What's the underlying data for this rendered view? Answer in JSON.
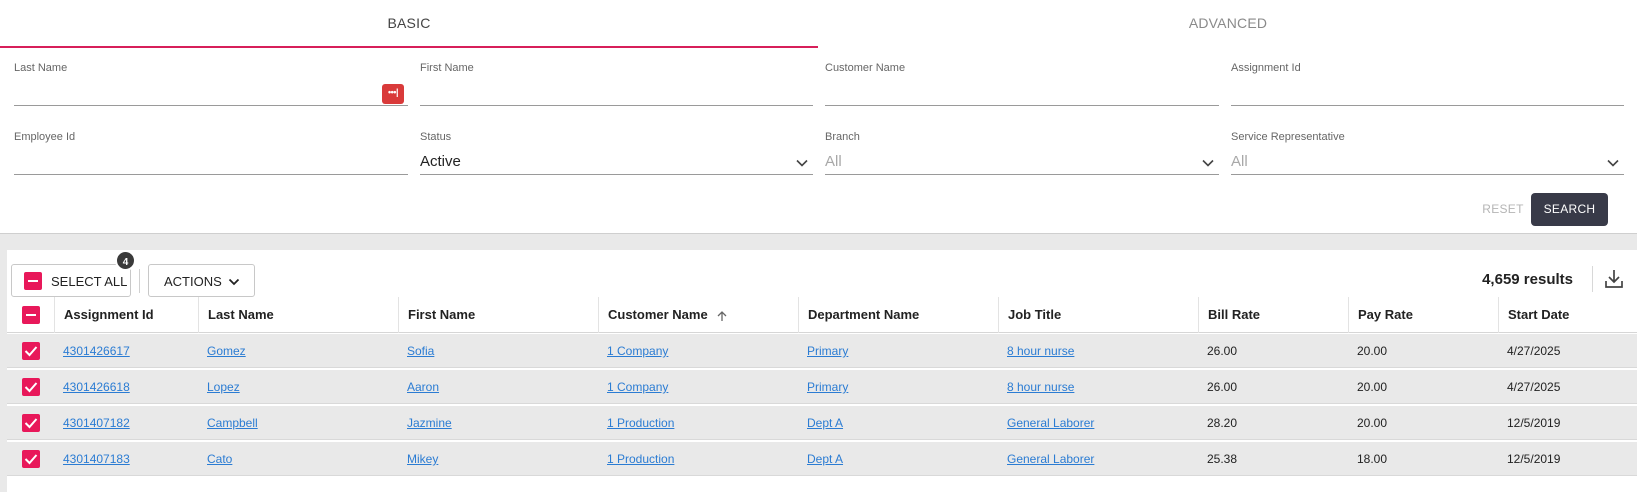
{
  "tabs": [
    {
      "label": "BASIC",
      "active": true
    },
    {
      "label": "ADVANCED",
      "active": false
    }
  ],
  "filters": {
    "last_name": {
      "label": "Last Name",
      "value": ""
    },
    "first_name": {
      "label": "First Name",
      "value": ""
    },
    "customer_name": {
      "label": "Customer Name",
      "value": ""
    },
    "assignment_id": {
      "label": "Assignment Id",
      "value": ""
    },
    "employee_id": {
      "label": "Employee Id",
      "value": ""
    },
    "status": {
      "label": "Status",
      "value": "Active"
    },
    "branch": {
      "label": "Branch",
      "placeholder": "All"
    },
    "service_rep": {
      "label": "Service Representative",
      "placeholder": "All"
    }
  },
  "buttons": {
    "reset": "RESET",
    "search": "SEARCH"
  },
  "toolbar": {
    "select_all": "SELECT ALL",
    "selected_count": "4",
    "actions": "ACTIONS",
    "results": "4,659 results"
  },
  "table": {
    "columns": [
      "Assignment Id",
      "Last Name",
      "First Name",
      "Customer Name",
      "Department Name",
      "Job Title",
      "Bill Rate",
      "Pay Rate",
      "Start Date"
    ],
    "sorted_column": "Customer Name",
    "sort_direction": "ascending",
    "rows": [
      {
        "checked": true,
        "assignment_id": "4301426617",
        "last_name": "Gomez",
        "first_name": "Sofia",
        "customer_name": "1 Company",
        "department_name": "Primary",
        "job_title": "8 hour nurse",
        "bill_rate": "26.00",
        "pay_rate": "20.00",
        "start_date": "4/27/2025"
      },
      {
        "checked": true,
        "assignment_id": "4301426618",
        "last_name": "Lopez",
        "first_name": "Aaron",
        "customer_name": "1 Company",
        "department_name": "Primary",
        "job_title": "8 hour nurse",
        "bill_rate": "26.00",
        "pay_rate": "20.00",
        "start_date": "4/27/2025"
      },
      {
        "checked": true,
        "assignment_id": "4301407182",
        "last_name": "Campbell",
        "first_name": "Jazmine",
        "customer_name": "1 Production",
        "department_name": "Dept A",
        "job_title": "General Laborer",
        "bill_rate": "28.20",
        "pay_rate": "20.00",
        "start_date": "12/5/2019"
      },
      {
        "checked": true,
        "assignment_id": "4301407183",
        "last_name": "Cato",
        "first_name": "Mikey",
        "customer_name": "1 Production",
        "department_name": "Dept A",
        "job_title": "General Laborer",
        "bill_rate": "25.38",
        "pay_rate": "18.00",
        "start_date": "12/5/2019"
      }
    ]
  },
  "colors": {
    "accent": "#e8185a",
    "link": "#2b7cd3",
    "search_button": "#383a48",
    "tab_underline": "#d71f5a"
  },
  "icons": {
    "password_manager": "keypass-icon",
    "dropdown": "chevron-down-icon",
    "download": "download-icon",
    "sort": "arrow-up-icon"
  }
}
